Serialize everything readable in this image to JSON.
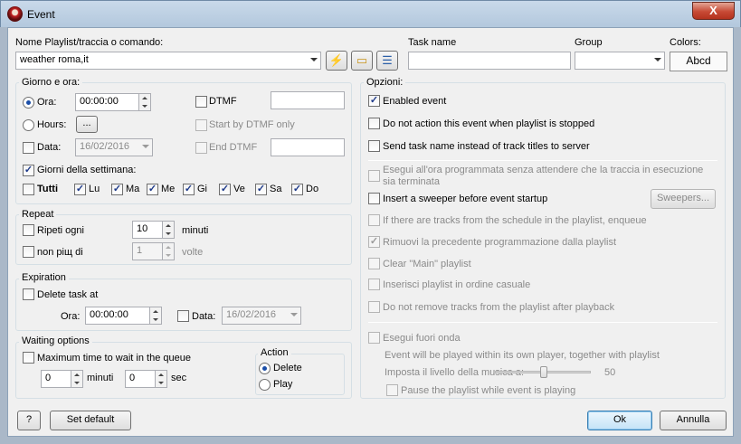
{
  "window": {
    "title": "Event",
    "close_label": "X"
  },
  "top": {
    "playlist_label": "Nome Playlist/traccia o comando:",
    "playlist_value": "weather roma,it",
    "task_name_label": "Task name",
    "task_name_value": "",
    "group_label": "Group",
    "group_value": "",
    "colors_label": "Colors:",
    "colors_button": "Abcd"
  },
  "schedule": {
    "title": "Giorno e ora:",
    "ora_label": "Ora:",
    "ora_value": "00:00:00",
    "hours_label": "Hours:",
    "hours_button": "...",
    "data_label": "Data:",
    "data_value": "16/02/2016",
    "dtmf_label": "DTMF",
    "dtmf_value": "",
    "start_dtmf_label": "Start by DTMF only",
    "end_dtmf_label": "End DTMF",
    "end_dtmf_value": "",
    "weekdays_label": "Giorni della settimana:",
    "tutti_label": "Tutti",
    "days": [
      "Lu",
      "Ma",
      "Me",
      "Gi",
      "Ve",
      "Sa",
      "Do"
    ]
  },
  "repeat": {
    "title": "Repeat",
    "every_label": "Ripeti ogni",
    "every_value": "10",
    "every_unit": "minuti",
    "not_more_label": "non piщ di",
    "not_more_value": "1",
    "not_more_unit": "volte"
  },
  "expiration": {
    "title": "Expiration",
    "delete_label": "Delete task at",
    "ora_label": "Ora:",
    "ora_value": "00:00:00",
    "data_label": "Data:",
    "data_value": "16/02/2016"
  },
  "waiting": {
    "title": "Waiting options",
    "max_label": "Maximum time to wait in the queue",
    "minutes_value": "0",
    "minutes_unit": "minuti",
    "seconds_value": "0",
    "seconds_unit": "sec",
    "action_title": "Action",
    "delete_label": "Delete",
    "play_label": "Play"
  },
  "options": {
    "title": "Opzioni:",
    "enabled": "Enabled event",
    "no_action": "Do not action this event when playlist is stopped",
    "send_task": "Send task name instead of track titles to server",
    "esegui_ora": "Esegui all'ora programmata senza attendere che la traccia in esecuzione sia terminata",
    "sweeper": "Insert a sweeper before event startup",
    "sweepers_button": "Sweepers...",
    "enqueue": "If there are tracks from the schedule in the playlist, enqueue",
    "rimuovi": "Rimuovi la precedente programmazione dalla playlist",
    "clear_main": "Clear \"Main\" playlist",
    "casuale": "Inserisci playlist in ordine casuale",
    "no_remove": "Do not remove tracks from the playlist after playback",
    "fuori_onda": "Esegui fuori onda",
    "own_player": "Event will be played within its own player, together with playlist",
    "volume_label": "Imposta il livello della musica a:",
    "volume_value": "50",
    "volume_level": 50,
    "pause": "Pause the playlist while event is playing"
  },
  "footer": {
    "help": "?",
    "set_default": "Set default",
    "ok": "Ok",
    "cancel": "Annulla"
  }
}
